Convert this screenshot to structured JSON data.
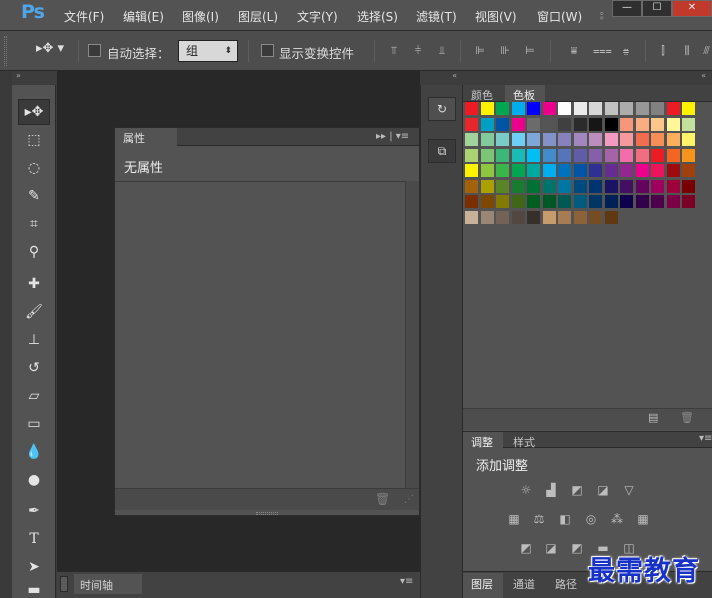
{
  "app": {
    "logo": "Ps"
  },
  "menubar": {
    "items": [
      "文件(F)",
      "编辑(E)",
      "图像(I)",
      "图层(L)",
      "文字(Y)",
      "选择(S)",
      "滤镜(T)",
      "视图(V)",
      "窗口(W)"
    ],
    "overflow": "⦂",
    "window_buttons": {
      "minimize": "—",
      "maximize": "☐",
      "close": "✕"
    }
  },
  "options_bar": {
    "auto_select_label": "自动选择：",
    "auto_select_value": "组",
    "show_transform_label": "显示变换控件"
  },
  "panels": {
    "properties": {
      "tab": "属性",
      "content": "无属性",
      "menu_icon": "▸▸ | ▾≡"
    },
    "timeline": {
      "tab": "时间轴"
    },
    "swatches": {
      "tabs": [
        "颜色",
        "色板"
      ],
      "active": "色板"
    },
    "adjustments": {
      "tabs": [
        "调整",
        "样式"
      ],
      "title": "添加调整"
    },
    "layers": {
      "tabs": [
        "图层",
        "通道",
        "路径"
      ]
    }
  },
  "watermark": "最需教育",
  "colors": {
    "ps_blue": "#4ea6e8",
    "bg_dark": "#282828",
    "panel": "#535353",
    "watermark": "#1832c8"
  },
  "swatch_rows": [
    [
      "#ed1c24",
      "#fff200",
      "#00a651",
      "#00aeef",
      "#0000ff",
      "#ec008c",
      "#ffffff",
      "#ebebeb",
      "#d7d7d7",
      "#c2c2c2",
      "#acacac",
      "#979797",
      "#818181",
      "#ed1c24",
      "#fff200"
    ],
    [
      "#e6262b",
      "#00a0c6",
      "#0054a6",
      "#ec008c",
      "#6b6b6b",
      "#555555",
      "#404040",
      "#2b2b2b",
      "#161616",
      "#000000",
      "#f7977a",
      "#f9ad81",
      "#fdc68a",
      "#fff79a",
      "#c4df9b"
    ],
    [
      "#a3d39c",
      "#82ca9c",
      "#7accc8",
      "#6dcff6",
      "#7da7d9",
      "#8393ca",
      "#8781bd",
      "#a187be",
      "#bc8dbf",
      "#f49ac2",
      "#f6989d",
      "#f26c4f",
      "#f68e55",
      "#fbaf5c",
      "#fff467"
    ],
    [
      "#acd372",
      "#7cc576",
      "#3bb878",
      "#1abbb4",
      "#00bff3",
      "#438ccb",
      "#5574b9",
      "#605ca8",
      "#855fa8",
      "#a763a8",
      "#f06ea9",
      "#f26d7d",
      "#ed1c24",
      "#f26522",
      "#f7941d"
    ],
    [
      "#fff200",
      "#8dc63f",
      "#39b54a",
      "#00a651",
      "#00a99d",
      "#00aeef",
      "#0072bc",
      "#0054a6",
      "#2e3192",
      "#662d91",
      "#92278f",
      "#ec008c",
      "#ed145b",
      "#9e0b0f",
      "#a0410d"
    ],
    [
      "#a36209",
      "#aba000",
      "#598527",
      "#197b30",
      "#007236",
      "#00746b",
      "#0076a3",
      "#004a80",
      "#003471",
      "#1b1464",
      "#440e62",
      "#630460",
      "#9e005d",
      "#9e0039",
      "#790000"
    ],
    [
      "#7b2e00",
      "#7d4900",
      "#827b00",
      "#406618",
      "#005e20",
      "#005826",
      "#005952",
      "#005b7f",
      "#003663",
      "#002157",
      "#0d004c",
      "#32004b",
      "#4b0049",
      "#7b0046",
      "#7a0026"
    ],
    [
      "#c7b299",
      "#998675",
      "#736357",
      "#534741",
      "#37302a",
      "#c69c6d",
      "#a67c52",
      "#8c6239",
      "#754c24",
      "#603913"
    ]
  ]
}
